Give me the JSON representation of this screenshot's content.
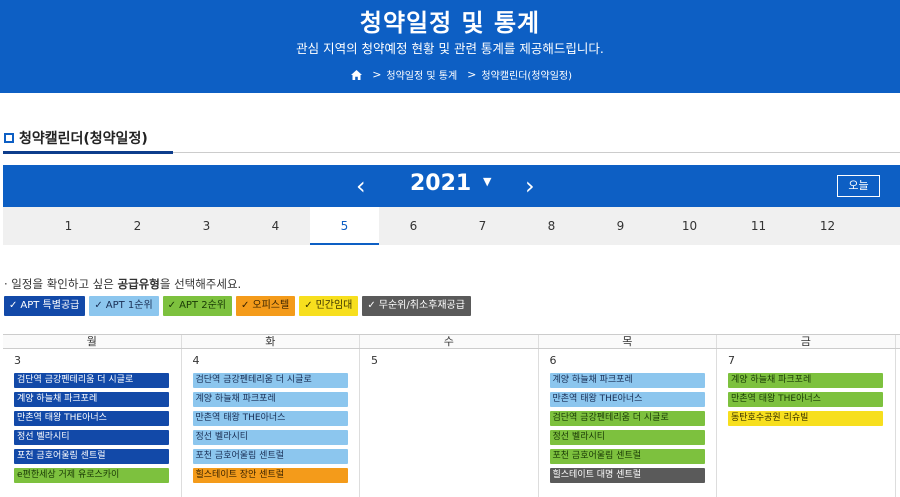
{
  "header": {
    "title": "청약일정 및 통계",
    "subtitle": "관심 지역의 청약예정 현황 및 관련 통계를 제공해드립니다.",
    "breadcrumb": [
      "청약일정 및 통계",
      "청약캘린더(청약일정)"
    ]
  },
  "section": {
    "title": "청약캘린더(청약일정)"
  },
  "calendar_nav": {
    "year": "2021",
    "today_label": "오늘",
    "months": [
      "1",
      "2",
      "3",
      "4",
      "5",
      "6",
      "7",
      "8",
      "9",
      "10",
      "11",
      "12"
    ],
    "selected_month": "5"
  },
  "hint": {
    "prefix": "· 일정을 확인하고 싶은 ",
    "bold": "공급유형",
    "suffix": "을 선택해주세요."
  },
  "filters": [
    {
      "label": "APT 특별공급",
      "color": "#1249a8",
      "text_color": "#ffffff"
    },
    {
      "label": "APT 1순위",
      "color": "#8cc6ee",
      "text_color": "#1a2f55"
    },
    {
      "label": "APT 2순위",
      "color": "#7dc13e",
      "text_color": "#1a3a06"
    },
    {
      "label": "오피스텔",
      "color": "#f49b1a",
      "text_color": "#3a2300"
    },
    {
      "label": "민간임대",
      "color": "#f7df1e",
      "text_color": "#3a3300"
    },
    {
      "label": "무순위/취소후재공급",
      "color": "#5a5a5a",
      "text_color": "#ffffff"
    }
  ],
  "weekdays": [
    "월",
    "화",
    "수",
    "목",
    "금"
  ],
  "days": [
    {
      "num": "3",
      "events": [
        {
          "name": "검단역 금강펜테리움 더 시글로",
          "type": 0
        },
        {
          "name": "계양 하늘채 파크포레",
          "type": 0
        },
        {
          "name": "만촌역 태왕 THE아너스",
          "type": 0
        },
        {
          "name": "정선 벨라시티",
          "type": 0
        },
        {
          "name": "포천 금호어울림 센트럴",
          "type": 0
        },
        {
          "name": "e편한세상 거제 유로스카이",
          "type": 2
        }
      ]
    },
    {
      "num": "4",
      "events": [
        {
          "name": "검단역 금강펜테리움 더 시글로",
          "type": 1
        },
        {
          "name": "계양 하늘채 파크포레",
          "type": 1
        },
        {
          "name": "만촌역 태왕 THE아너스",
          "type": 1
        },
        {
          "name": "정선 벨라시티",
          "type": 1
        },
        {
          "name": "포천 금호어울림 센트럴",
          "type": 1
        },
        {
          "name": "힐스테이트 장안 센트럴",
          "type": 3
        }
      ]
    },
    {
      "num": "5",
      "events": []
    },
    {
      "num": "6",
      "events": [
        {
          "name": "계양 하늘채 파크포레",
          "type": 1
        },
        {
          "name": "만촌역 태왕 THE아너스",
          "type": 1
        },
        {
          "name": "검단역 금강펜테리움 더 시글로",
          "type": 2
        },
        {
          "name": "정선 벨라시티",
          "type": 2
        },
        {
          "name": "포천 금호어울림 센트럴",
          "type": 2
        },
        {
          "name": "힐스테이트 대명 센트럴",
          "type": 5
        }
      ]
    },
    {
      "num": "7",
      "events": [
        {
          "name": "계양 하늘채 파크포레",
          "type": 2
        },
        {
          "name": "만촌역 태왕 THE아너스",
          "type": 2
        },
        {
          "name": "동탄호수공원 리슈빌",
          "type": 4
        }
      ]
    }
  ]
}
